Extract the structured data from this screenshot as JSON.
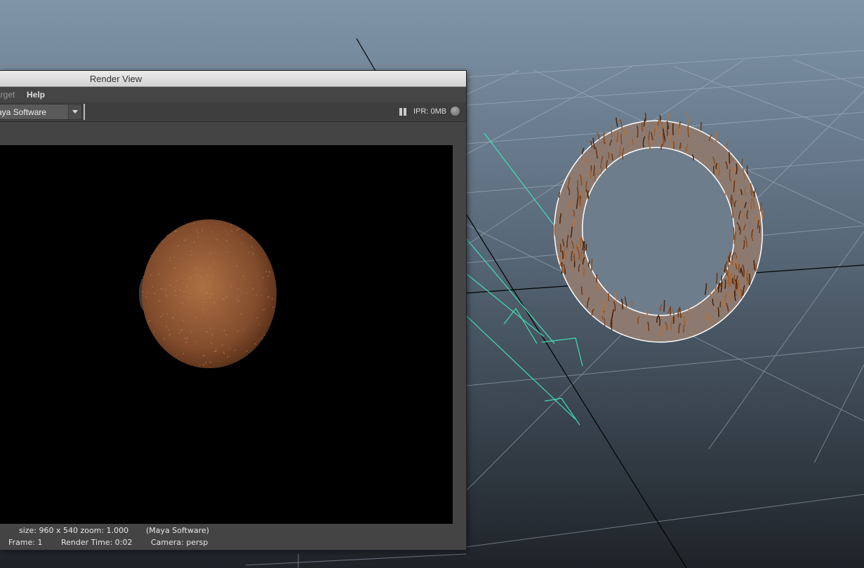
{
  "window": {
    "title": "Render View"
  },
  "menu": {
    "items": [
      {
        "label": "arget"
      },
      {
        "label": "Help"
      }
    ]
  },
  "toolbar": {
    "renderer": "aya Software",
    "ipr_label": "IPR: 0MB"
  },
  "status": {
    "size_zoom": "size: 960 x 540 zoom: 1.000",
    "renderer": "(Maya Software)",
    "frame": "Frame: 1",
    "render_time": "Render Time: 0:02",
    "camera": "Camera: persp"
  },
  "colors": {
    "fur": "#8a5130",
    "light_manip": "#3fe0b0",
    "grid": "#9fb0bf",
    "selection": "#ffffff"
  },
  "icons": [
    "pause-icon",
    "ipr-status-icon",
    "dropdown-arrow-icon"
  ]
}
